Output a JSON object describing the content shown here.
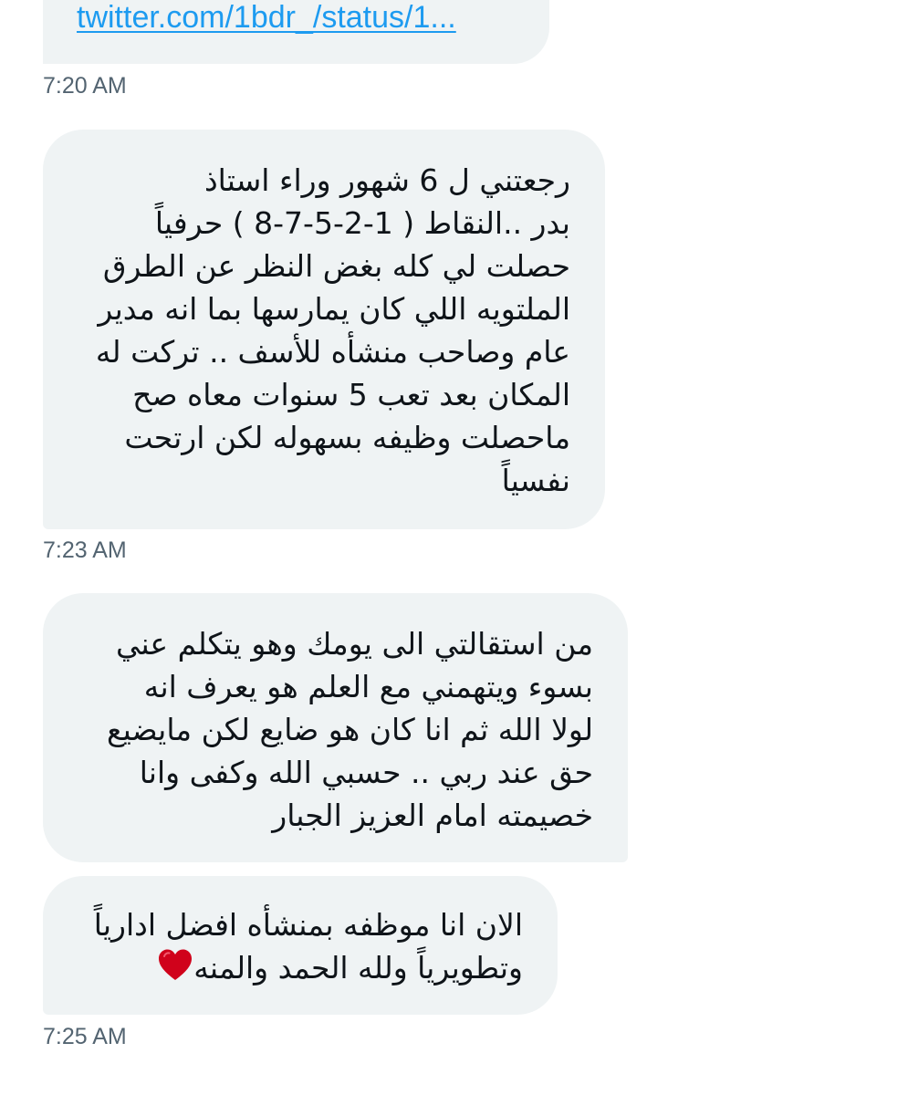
{
  "messages": [
    {
      "type": "link",
      "link_text": "twitter.com/1bdr_/status/1...",
      "timestamp": "7:20 AM"
    },
    {
      "type": "text",
      "lines": [
        "رجعتني ل 6 شهور وراء استاذ",
        "بدر ..النقاط ( 1-2-5-7-8 ) حرفياً",
        "حصلت لي كله بغض النظر عن الطرق",
        "الملتويه اللي كان يمارسها بما انه مدير",
        "عام وصاحب منشأه للأسف .. تركت له",
        "المكان بعد تعب 5 سنوات معاه صح",
        "ماحصلت وظيفه بسهوله لكن ارتحت",
        "نفسياً"
      ],
      "timestamp": "7:23 AM"
    },
    {
      "type": "text",
      "lines": [
        "من استقالتي الى يومك وهو يتكلم عني",
        "بسوء ويتهمني مع العلم هو يعرف انه",
        "لولا الله ثم انا كان هو ضايع لكن مايضيع",
        "حق عند ربي .. حسبي الله وكفى وانا",
        "خصيمته امام العزيز الجبار"
      ]
    },
    {
      "type": "text",
      "lines": [
        "الان انا موظفه بمنشأه افضل ادارياً",
        "وتطويرياً  ولله الحمد والمنه"
      ],
      "emoji": "heart-icon",
      "timestamp": "7:25 AM"
    }
  ],
  "colors": {
    "bubble": "#eff3f4",
    "text": "#0f1419",
    "link": "#1d9bf0",
    "timestamp": "#536471",
    "heart": "#d0021b"
  }
}
